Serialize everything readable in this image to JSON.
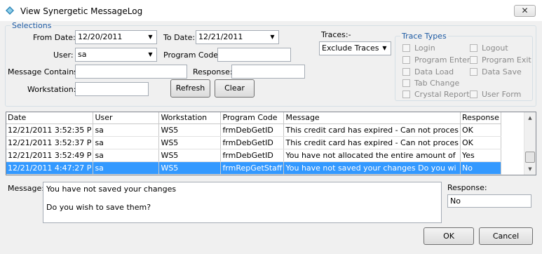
{
  "window": {
    "title": "View Synergetic MessageLog",
    "close_glyph": "✕"
  },
  "selections": {
    "legend": "Selections",
    "from_date_label": "From Date:",
    "from_date_value": "12/20/2011",
    "to_date_label": "To Date:",
    "to_date_value": "12/21/2011",
    "user_label": "User:",
    "user_value": "sa",
    "program_code_label": "Program Code:",
    "program_code_value": "",
    "message_contains_label": "Message Contains:",
    "message_contains_value": "",
    "response_label": "Response:",
    "response_value": "",
    "workstation_label": "Workstation:",
    "workstation_value": "",
    "refresh_label": "Refresh",
    "clear_label": "Clear"
  },
  "traces": {
    "label": "Traces:-",
    "value": "Exclude Traces"
  },
  "trace_types": {
    "legend": "Trace Types",
    "items": [
      "Login",
      "Logout",
      "Program Enter",
      "Program Exit",
      "Data Load",
      "Data Save",
      "Tab Change",
      "Crystal Report",
      "User Form"
    ]
  },
  "grid": {
    "columns": [
      "Date",
      "User",
      "Workstation",
      "Program Code",
      "Message",
      "Response"
    ],
    "rows": [
      [
        "12/21/2011 3:52:35 P",
        "sa",
        "WS5",
        "frmDebGetID",
        "This credit card has expired - Can not proces",
        "OK"
      ],
      [
        "12/21/2011 3:52:37 P",
        "sa",
        "WS5",
        "frmDebGetID",
        "This credit card has expired - Can not proces",
        "OK"
      ],
      [
        "12/21/2011 3:52:49 P",
        "sa",
        "WS5",
        "frmDebGetID",
        "You have not allocated the entire amount of",
        "Yes"
      ],
      [
        "12/21/2011 4:47:27 P",
        "sa",
        "WS5",
        "frmRepGetStaff",
        "You have not saved your changes  Do you wi",
        "No"
      ]
    ],
    "selected_row": 3
  },
  "detail": {
    "message_label": "Message:",
    "message_line1": "You have not saved your changes",
    "message_line2": "Do you wish to save them?",
    "response_label": "Response:",
    "response_value": "No"
  },
  "buttons": {
    "ok": "OK",
    "cancel": "Cancel"
  },
  "colors": {
    "selection": "#3399ff",
    "legend": "#1c5aa3"
  }
}
